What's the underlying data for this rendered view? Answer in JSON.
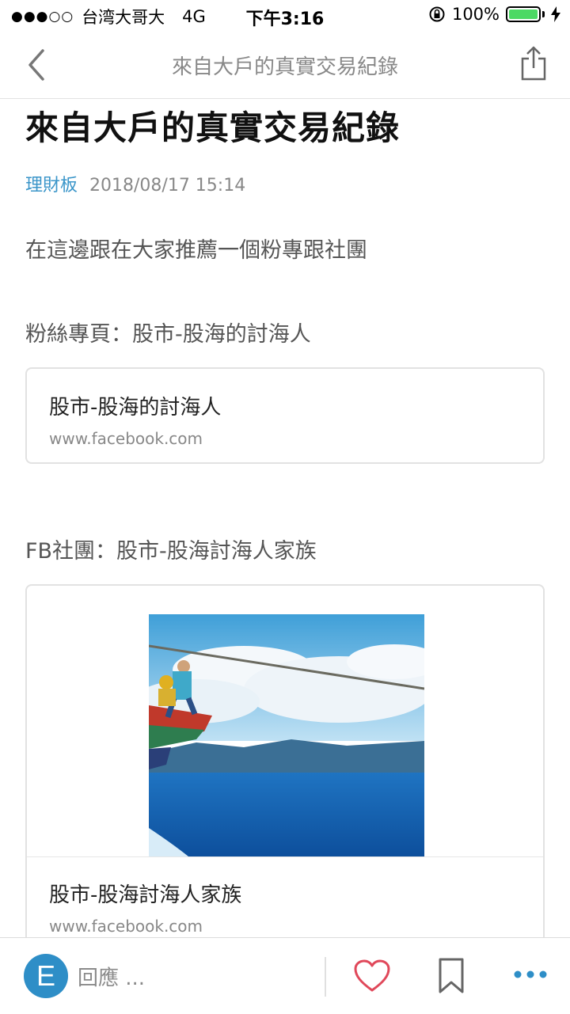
{
  "status_bar": {
    "signal": "●●●○○",
    "carrier": "台湾大哥大",
    "network": "4G",
    "time": "下午3:16",
    "battery_text": "100%",
    "battery_level": 1.0
  },
  "nav": {
    "title": "來自大戶的真實交易紀錄"
  },
  "article": {
    "title": "來自大戶的真實交易紀錄",
    "board": "理財板",
    "date": "2018/08/17 15:14",
    "paragraph1": "在這邊跟在大家推薦一個粉專跟社團",
    "paragraph2": "粉絲專頁：股市-股海的討海人",
    "paragraph3": "FB社團：股市-股海討海人家族"
  },
  "link_cards": [
    {
      "title": "股市-股海的討海人",
      "url": "www.facebook.com"
    },
    {
      "title": "股市-股海討海人家族",
      "url": "www.facebook.com"
    }
  ],
  "bottom_bar": {
    "avatar_letter": "E",
    "reply_placeholder": "回應 ...",
    "accent_color": "#2e8ec7",
    "heart_color": "#e0485a"
  },
  "colors": {
    "board_link": "#3a95c9",
    "battery_green": "#4cd964"
  }
}
